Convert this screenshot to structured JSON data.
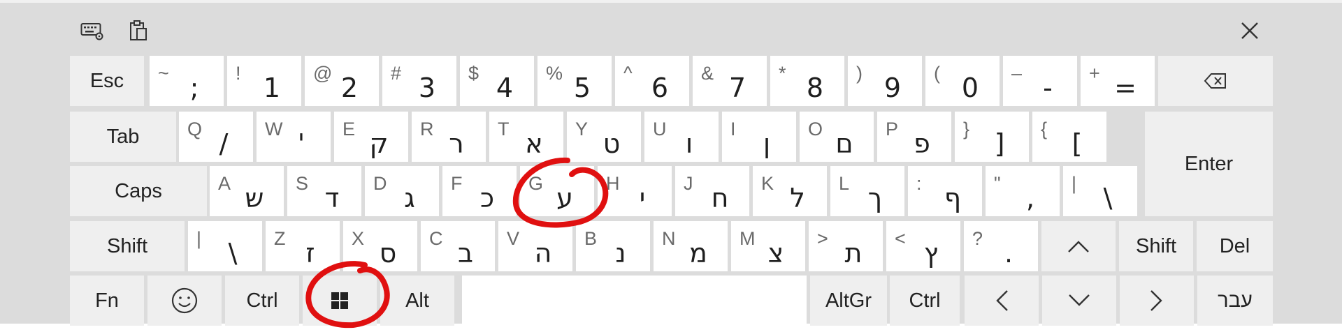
{
  "icons": {
    "keyboard_settings": "keyboard-settings-icon",
    "clipboard": "clipboard-icon",
    "close": "close-icon",
    "backspace": "backspace-icon",
    "emoji": "emoji-icon",
    "windows": "windows-logo-icon",
    "arrow_up": "chevron-up-icon",
    "arrow_down": "chevron-down-icon",
    "arrow_left": "chevron-left-icon",
    "arrow_right": "chevron-right-icon"
  },
  "colors": {
    "panel": "#dcdcdc",
    "key": "#ffffff",
    "function_key": "#efefef",
    "annotation": "#e01010"
  },
  "keys": [
    {
      "id": "esc",
      "label": "Esc"
    },
    {
      "id": "semicolon",
      "latin": "~",
      "main": ";"
    },
    {
      "id": "1",
      "latin": "!",
      "main": "1"
    },
    {
      "id": "2",
      "latin": "@",
      "main": "2"
    },
    {
      "id": "3",
      "latin": "#",
      "main": "3"
    },
    {
      "id": "4",
      "latin": "$",
      "main": "4"
    },
    {
      "id": "5",
      "latin": "%",
      "main": "5"
    },
    {
      "id": "6",
      "latin": "^",
      "main": "6"
    },
    {
      "id": "7",
      "latin": "&",
      "main": "7"
    },
    {
      "id": "8",
      "latin": "*",
      "main": "8"
    },
    {
      "id": "9",
      "latin": ")",
      "main": "9"
    },
    {
      "id": "0",
      "latin": "(",
      "main": "0"
    },
    {
      "id": "minus",
      "latin": "–",
      "main": "-"
    },
    {
      "id": "equals",
      "latin": "+",
      "main": "="
    },
    {
      "id": "backspace",
      "icon": "backspace"
    },
    {
      "id": "tab",
      "label": "Tab"
    },
    {
      "id": "q",
      "latin": "Q",
      "main": "/"
    },
    {
      "id": "w",
      "latin": "W",
      "main": "'"
    },
    {
      "id": "e",
      "latin": "E",
      "main": "ק"
    },
    {
      "id": "r",
      "latin": "R",
      "main": "ר"
    },
    {
      "id": "t",
      "latin": "T",
      "main": "א"
    },
    {
      "id": "y",
      "latin": "Y",
      "main": "ט"
    },
    {
      "id": "u",
      "latin": "U",
      "main": "ו"
    },
    {
      "id": "i",
      "latin": "I",
      "main": "ן"
    },
    {
      "id": "o",
      "latin": "O",
      "main": "ם"
    },
    {
      "id": "p",
      "latin": "P",
      "main": "פ"
    },
    {
      "id": "rbrace",
      "latin": "}",
      "main": "]"
    },
    {
      "id": "lbrace",
      "latin": "{",
      "main": "["
    },
    {
      "id": "enter",
      "label": "Enter"
    },
    {
      "id": "caps",
      "label": "Caps"
    },
    {
      "id": "a",
      "latin": "A",
      "main": "ש"
    },
    {
      "id": "s",
      "latin": "S",
      "main": "ד"
    },
    {
      "id": "d",
      "latin": "D",
      "main": "ג"
    },
    {
      "id": "f",
      "latin": "F",
      "main": "כ"
    },
    {
      "id": "g",
      "latin": "G",
      "main": "ע"
    },
    {
      "id": "h",
      "latin": "H",
      "main": "י"
    },
    {
      "id": "j",
      "latin": "J",
      "main": "ח"
    },
    {
      "id": "k",
      "latin": "K",
      "main": "ל"
    },
    {
      "id": "l",
      "latin": "L",
      "main": "ך"
    },
    {
      "id": "colon",
      "latin": ":",
      "main": "ף"
    },
    {
      "id": "quote",
      "latin": "\"",
      "main": ","
    },
    {
      "id": "pipe",
      "latin": "|",
      "main": "\\"
    },
    {
      "id": "shift-left",
      "label": "Shift"
    },
    {
      "id": "backslash",
      "latin": "|",
      "main": "\\"
    },
    {
      "id": "z",
      "latin": "Z",
      "main": "ז"
    },
    {
      "id": "x",
      "latin": "X",
      "main": "ס"
    },
    {
      "id": "c",
      "latin": "C",
      "main": "ב"
    },
    {
      "id": "v",
      "latin": "V",
      "main": "ה"
    },
    {
      "id": "b",
      "latin": "B",
      "main": "נ"
    },
    {
      "id": "n",
      "latin": "N",
      "main": "מ"
    },
    {
      "id": "m",
      "latin": "M",
      "main": "צ"
    },
    {
      "id": "period",
      "latin": ">",
      "main": "ת"
    },
    {
      "id": "comma",
      "latin": "<",
      "main": "ץ"
    },
    {
      "id": "slash",
      "latin": "?",
      "main": "."
    },
    {
      "id": "up",
      "icon": "arrow_up"
    },
    {
      "id": "shift-right",
      "label": "Shift"
    },
    {
      "id": "del",
      "label": "Del"
    },
    {
      "id": "fn",
      "label": "Fn"
    },
    {
      "id": "emoji",
      "icon": "emoji"
    },
    {
      "id": "ctrl-left",
      "label": "Ctrl"
    },
    {
      "id": "windows",
      "icon": "windows"
    },
    {
      "id": "alt",
      "label": "Alt"
    },
    {
      "id": "space",
      "label": ""
    },
    {
      "id": "altgr",
      "label": "AltGr"
    },
    {
      "id": "ctrl-right",
      "label": "Ctrl"
    },
    {
      "id": "left",
      "icon": "arrow_left"
    },
    {
      "id": "down",
      "icon": "arrow_down"
    },
    {
      "id": "right",
      "icon": "arrow_right"
    },
    {
      "id": "language",
      "label": "עבר"
    }
  ]
}
